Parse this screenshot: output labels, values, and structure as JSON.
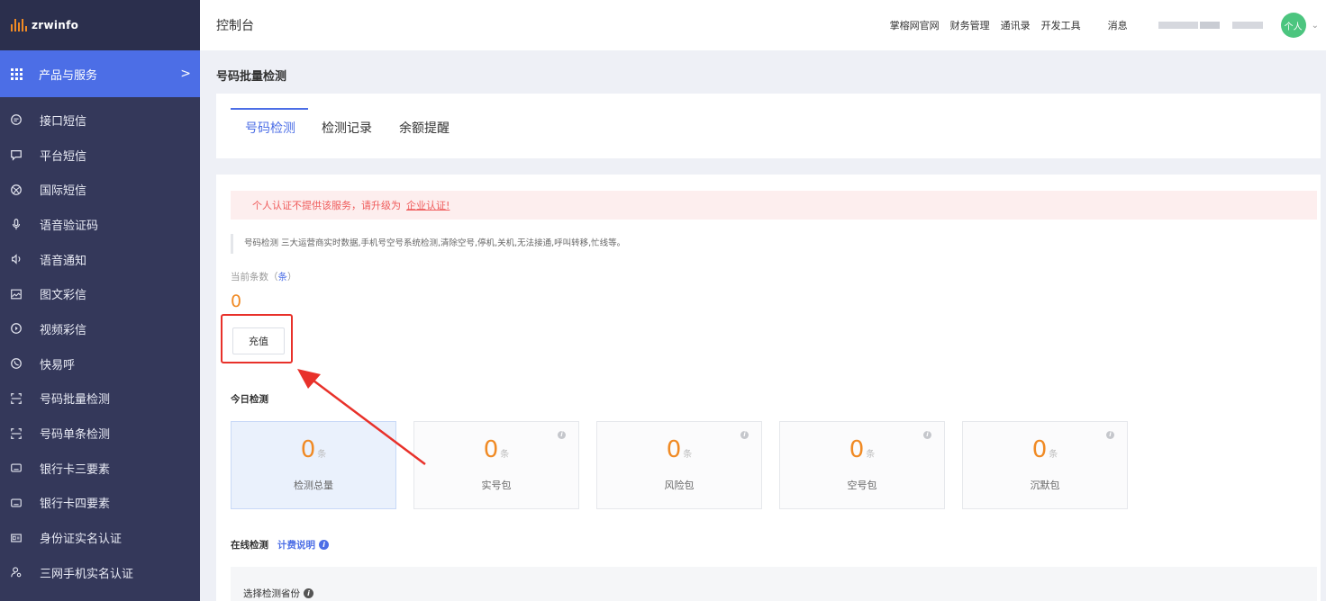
{
  "logo": {
    "text": "zrwinfo"
  },
  "sidebar": {
    "active": {
      "label": "产品与服务",
      "chevron": ">"
    },
    "items": [
      {
        "label": "接口短信",
        "icon": "chat-bubble-icon"
      },
      {
        "label": "平台短信",
        "icon": "message-square-icon"
      },
      {
        "label": "国际短信",
        "icon": "globe-icon"
      },
      {
        "label": "语音验证码",
        "icon": "microphone-icon"
      },
      {
        "label": "语音通知",
        "icon": "speaker-icon"
      },
      {
        "label": "图文彩信",
        "icon": "image-icon"
      },
      {
        "label": "视频彩信",
        "icon": "play-circle-icon"
      },
      {
        "label": "快易呼",
        "icon": "phone-circle-icon"
      },
      {
        "label": "号码批量检测",
        "icon": "scan-icon"
      },
      {
        "label": "号码单条检测",
        "icon": "scan-icon"
      },
      {
        "label": "银行卡三要素",
        "icon": "card-icon"
      },
      {
        "label": "银行卡四要素",
        "icon": "card-icon"
      },
      {
        "label": "身份证实名认证",
        "icon": "id-card-icon"
      },
      {
        "label": "三网手机实名认证",
        "icon": "user-icon"
      }
    ]
  },
  "header": {
    "title": "控制台",
    "links": [
      "掌榕网官网",
      "财务管理",
      "通讯录",
      "开发工具"
    ],
    "message": "消息",
    "avatar": "个人",
    "caret": "⌄"
  },
  "page": {
    "title": "号码批量检测"
  },
  "tabs": [
    {
      "label": "号码检测",
      "active": true
    },
    {
      "label": "检测记录",
      "active": false
    },
    {
      "label": "余额提醒",
      "active": false
    }
  ],
  "alert": {
    "text": "个人认证不提供该服务，请升级为",
    "link": "企业认证!"
  },
  "description": "号码检测 三大运营商实时数据,手机号空号系统检测,清除空号,停机,关机,无法接通,呼叫转移,忙线等。",
  "balance": {
    "label": "当前条数（",
    "unit": "条",
    "close": "）",
    "value": "0",
    "recharge": "充值"
  },
  "today": {
    "title": "今日检测",
    "stats": [
      {
        "value": "0",
        "unit": "条",
        "label": "检测总量"
      },
      {
        "value": "0",
        "unit": "条",
        "label": "实号包"
      },
      {
        "value": "0",
        "unit": "条",
        "label": "风险包"
      },
      {
        "value": "0",
        "unit": "条",
        "label": "空号包"
      },
      {
        "value": "0",
        "unit": "条",
        "label": "沉默包"
      }
    ]
  },
  "online": {
    "title": "在线检测",
    "pricing": "计费说明"
  },
  "province": {
    "label": "选择检测省份"
  },
  "colors": {
    "sidebar": "#34385a",
    "accent": "#4c6ee6",
    "orange": "#f08a24",
    "highlight": "#e8312a"
  }
}
